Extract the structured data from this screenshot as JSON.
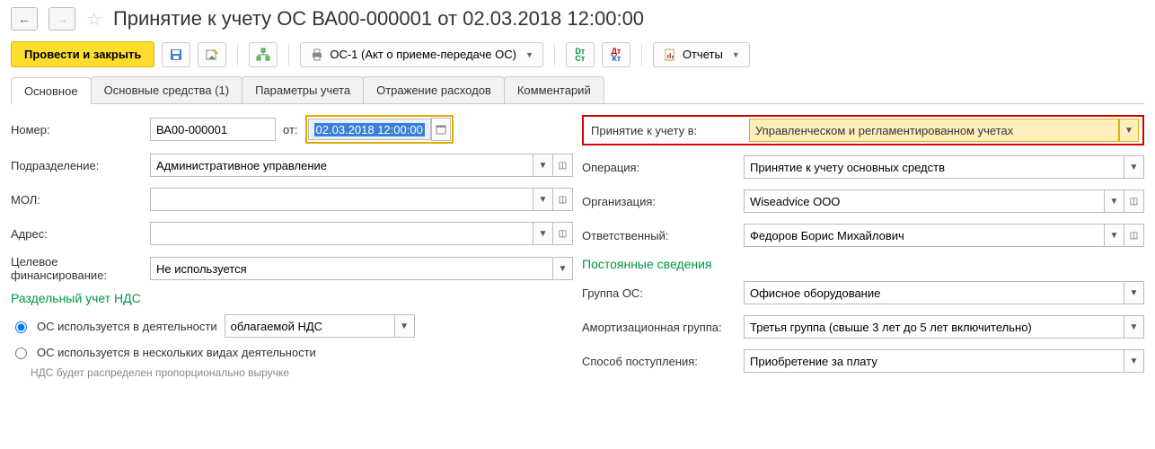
{
  "title": "Принятие к учету ОС ВА00-000001 от 02.03.2018 12:00:00",
  "toolbar": {
    "post_close": "Провести и закрыть",
    "os1": "ОС-1 (Акт о приеме-передаче ОС)",
    "reports": "Отчеты"
  },
  "tabs": {
    "main": "Основное",
    "assets": "Основные средства (1)",
    "params": "Параметры учета",
    "expenses": "Отражение расходов",
    "comment": "Комментарий"
  },
  "left": {
    "number_label": "Номер:",
    "number_value": "ВА00-000001",
    "from_label": "от:",
    "date_value": "02.03.2018 12:00:00",
    "dept_label": "Подразделение:",
    "dept_value": "Административное управление",
    "mol_label": "МОЛ:",
    "mol_value": "",
    "addr_label": "Адрес:",
    "addr_value": "",
    "target_label": "Целевое финансирование:",
    "target_value": "Не используется",
    "vat_section": "Раздельный учет НДС",
    "radio1": "ОС используется в деятельности",
    "radio1_val": "облагаемой НДС",
    "radio2": "ОС используется в нескольких видах деятельности",
    "hint": "НДС будет распределен пропорционально выручке"
  },
  "right": {
    "accept_label": "Принятие к учету в:",
    "accept_value": "Управленческом и регламентированном учетах",
    "oper_label": "Операция:",
    "oper_value": "Принятие к учету основных средств",
    "org_label": "Организация:",
    "org_value": "Wiseadvice ООО",
    "resp_label": "Ответственный:",
    "resp_value": "Федоров Борис Михайлович",
    "const_section": "Постоянные сведения",
    "group_label": "Группа ОС:",
    "group_value": "Офисное оборудование",
    "amort_label": "Амортизационная группа:",
    "amort_value": "Третья группа (свыше 3 лет до 5 лет включительно)",
    "income_label": "Способ поступления:",
    "income_value": "Приобретение за плату"
  }
}
